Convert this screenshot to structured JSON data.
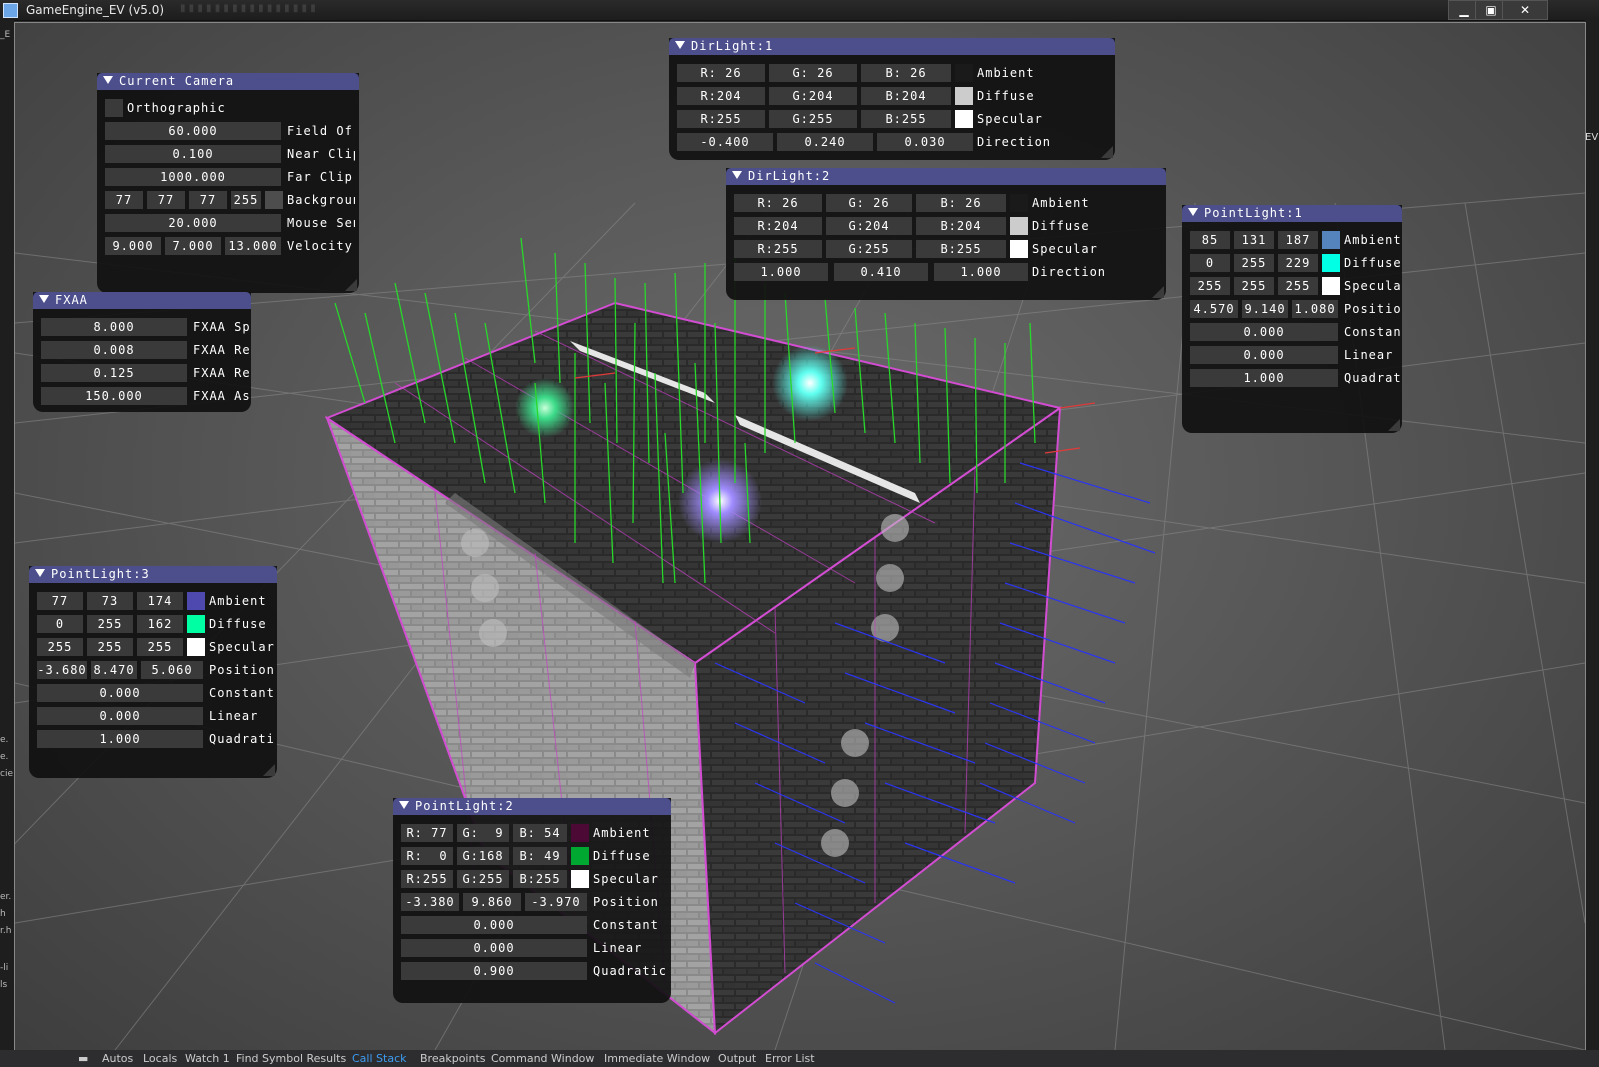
{
  "window": {
    "title": "GameEngine_EV (v5.0)",
    "buttons": {
      "minimize": "▁",
      "maximize": "▣",
      "close": "✕"
    }
  },
  "left_strip": {
    "fragments": [
      "_E",
      "e.",
      "e.",
      "cie",
      "er.",
      "h",
      "r.h",
      "-li",
      "ls"
    ]
  },
  "right_strip": {
    "fragment": "EV"
  },
  "status_tabs": [
    "Autos",
    "Locals",
    "Watch 1",
    "Find Symbol Results",
    "Call Stack",
    "Breakpoints",
    "Command Window",
    "Immediate Window",
    "Output",
    "Error List"
  ],
  "current_camera": {
    "title": "Current Camera",
    "orthographic_label": "Orthographic",
    "fov": {
      "value": "60.000",
      "label": "Field Of"
    },
    "near": {
      "value": "0.100",
      "label": "Near Clip"
    },
    "far": {
      "value": "1000.000",
      "label": "Far Clip"
    },
    "background": {
      "r": "77",
      "g": "77",
      "b": "77",
      "a": "255",
      "label": "Backgroun"
    },
    "mouse": {
      "value": "20.000",
      "label": "Mouse Sen"
    },
    "velocity": {
      "x": "9.000",
      "y": "7.000",
      "z": "13.000",
      "label": "Velocity"
    }
  },
  "fxaa": {
    "title": "FXAA",
    "rows": [
      {
        "value": "8.000",
        "label": "FXAA Sp"
      },
      {
        "value": "0.008",
        "label": "FXAA Re"
      },
      {
        "value": "0.125",
        "label": "FXAA Re"
      },
      {
        "value": "150.000",
        "label": "FXAA As"
      }
    ]
  },
  "dirlight1": {
    "title": "DirLight:1",
    "ambient": {
      "r": "R: 26",
      "g": "G: 26",
      "b": "B: 26",
      "label": "Ambient"
    },
    "diffuse": {
      "r": "R:204",
      "g": "G:204",
      "b": "B:204",
      "label": "Diffuse",
      "color": "#cccccc"
    },
    "specular": {
      "r": "R:255",
      "g": "G:255",
      "b": "B:255",
      "label": "Specular",
      "color": "#ffffff"
    },
    "direction": {
      "x": "-0.400",
      "y": "0.240",
      "z": "0.030",
      "label": "Direction"
    }
  },
  "dirlight2": {
    "title": "DirLight:2",
    "ambient": {
      "r": "R: 26",
      "g": "G: 26",
      "b": "B: 26",
      "label": "Ambient"
    },
    "diffuse": {
      "r": "R:204",
      "g": "G:204",
      "b": "B:204",
      "label": "Diffuse",
      "color": "#cccccc"
    },
    "specular": {
      "r": "R:255",
      "g": "G:255",
      "b": "B:255",
      "label": "Specular",
      "color": "#ffffff"
    },
    "direction": {
      "x": "1.000",
      "y": "0.410",
      "z": "1.000",
      "label": "Direction"
    }
  },
  "pointlight1": {
    "title": "PointLight:1",
    "ambient": {
      "r": "85",
      "g": "131",
      "b": "187",
      "label": "Ambient",
      "color": "#5583bb"
    },
    "diffuse": {
      "r": "0",
      "g": "255",
      "b": "229",
      "label": "Diffuse",
      "color": "#00ffe5"
    },
    "specular": {
      "r": "255",
      "g": "255",
      "b": "255",
      "label": "Specula",
      "color": "#ffffff"
    },
    "position": {
      "x": "4.570",
      "y": "9.140",
      "z": "1.080",
      "label": "Positio"
    },
    "constant": {
      "value": "0.000",
      "label": "Constan"
    },
    "linear": {
      "value": "0.000",
      "label": "Linear"
    },
    "quadratic": {
      "value": "1.000",
      "label": "Quadrat"
    }
  },
  "pointlight3": {
    "title": "PointLight:3",
    "ambient": {
      "r": "77",
      "g": "73",
      "b": "174",
      "label": "Ambient",
      "color": "#4d49ae"
    },
    "diffuse": {
      "r": "0",
      "g": "255",
      "b": "162",
      "label": "Diffuse",
      "color": "#00ffa2"
    },
    "specular": {
      "r": "255",
      "g": "255",
      "b": "255",
      "label": "Specular",
      "color": "#ffffff"
    },
    "position": {
      "x": "-3.680",
      "y": "8.470",
      "z": "5.060",
      "label": "Position"
    },
    "constant": {
      "value": "0.000",
      "label": "Constant"
    },
    "linear": {
      "value": "0.000",
      "label": "Linear"
    },
    "quadratic": {
      "value": "1.000",
      "label": "Quadrati"
    }
  },
  "pointlight2": {
    "title": "PointLight:2",
    "ambient": {
      "r": "R: 77",
      "g": "G:  9",
      "b": "B: 54",
      "label": "Ambient",
      "color": "#4d0936"
    },
    "diffuse": {
      "r": "R:  0",
      "g": "G:168",
      "b": "B: 49",
      "label": "Diffuse",
      "color": "#00a831"
    },
    "specular": {
      "r": "R:255",
      "g": "G:255",
      "b": "B:255",
      "label": "Specular",
      "color": "#ffffff"
    },
    "position": {
      "x": "-3.380",
      "y": "9.860",
      "z": "-3.970",
      "label": "Position"
    },
    "constant": {
      "value": "0.000",
      "label": "Constant"
    },
    "linear": {
      "value": "0.000",
      "label": "Linear"
    },
    "quadratic": {
      "value": "0.900",
      "label": "Quadratic"
    }
  }
}
